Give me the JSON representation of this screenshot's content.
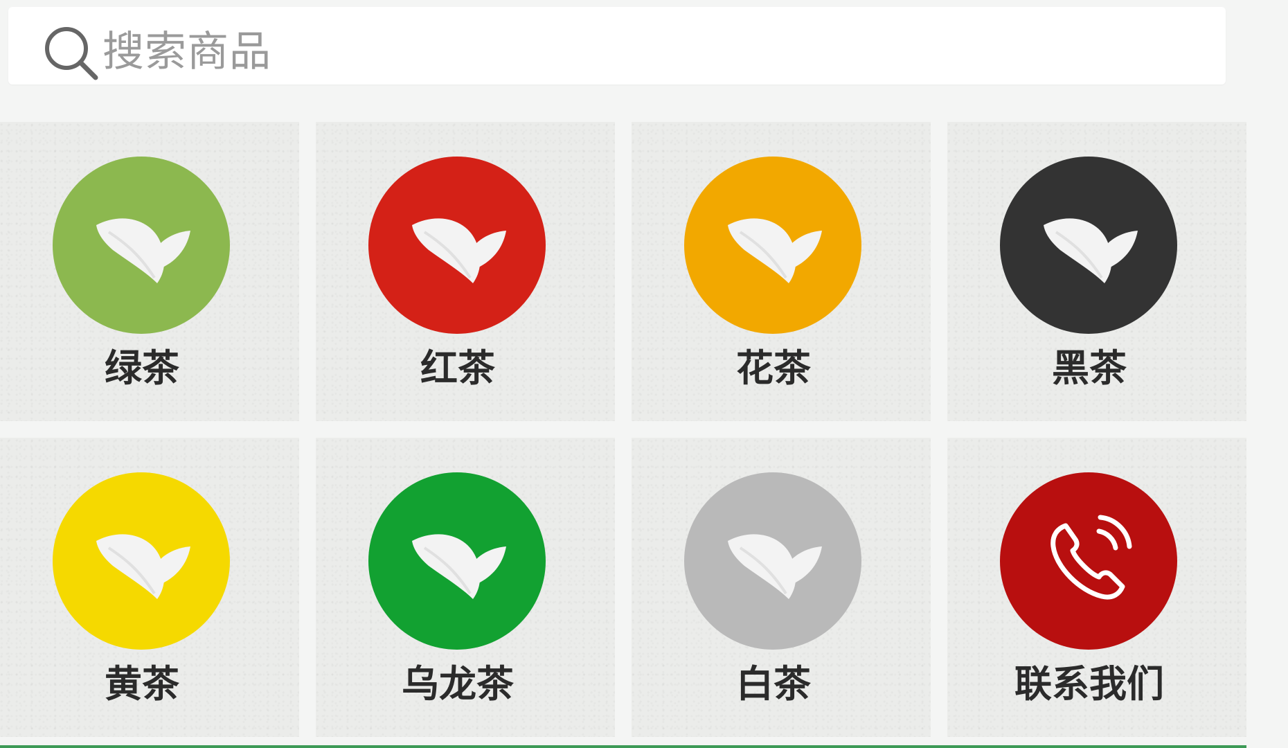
{
  "search": {
    "placeholder": "搜索商品"
  },
  "categories": [
    {
      "label": "绿茶",
      "color": "#8cb84f",
      "icon": "leaf-icon"
    },
    {
      "label": "红茶",
      "color": "#d42117",
      "icon": "leaf-icon"
    },
    {
      "label": "花茶",
      "color": "#f2a800",
      "icon": "leaf-icon"
    },
    {
      "label": "黑茶",
      "color": "#333333",
      "icon": "leaf-icon"
    },
    {
      "label": "黄茶",
      "color": "#f5d900",
      "icon": "leaf-icon"
    },
    {
      "label": "乌龙茶",
      "color": "#12a131",
      "icon": "leaf-icon"
    },
    {
      "label": "白茶",
      "color": "#b9b9b9",
      "icon": "leaf-icon"
    },
    {
      "label": "联系我们",
      "color": "#b80f0f",
      "icon": "phone-icon"
    }
  ]
}
